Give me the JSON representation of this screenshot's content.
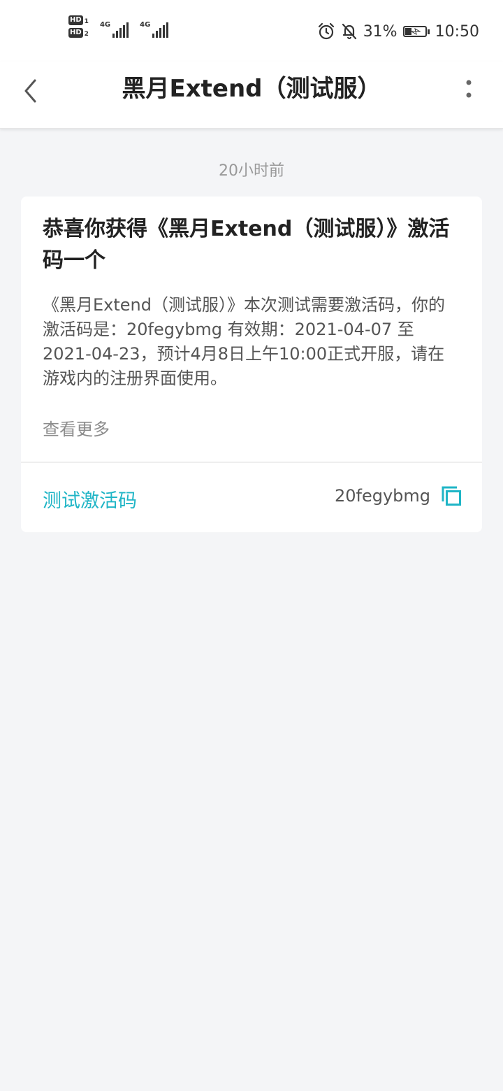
{
  "status_bar": {
    "hd1": "HD",
    "hd1_sub": "1",
    "hd2": "HD",
    "hd2_sub": "2",
    "signal1_label": "4G",
    "signal2_label": "4G",
    "battery_percent": "31%",
    "time": "10:50",
    "battery_level": 0.31
  },
  "header": {
    "title": "黑月Extend（测试服）"
  },
  "message": {
    "timestamp": "20小时前",
    "title": "恭喜你获得《黑月Extend（测试服）》激活码一个",
    "body": "《黑月Extend（测试服）》本次测试需要激活码，你的激活码是：20fegybmg 有效期：2021-04-07 至 2021-04-23，预计4月8日上午10:00正式开服，请在游戏内的注册界面使用。",
    "view_more": "查看更多",
    "code_label": "测试激活码",
    "code_value": "20fegybmg"
  },
  "icons": {
    "back": "chevron-left-icon",
    "more": "more-vertical-icon",
    "copy": "copy-icon",
    "alarm": "alarm-icon",
    "mute": "bell-off-icon",
    "battery": "battery-charging-icon"
  },
  "colors": {
    "accent": "#1fb5c6",
    "background": "#f4f5f7",
    "card": "#ffffff"
  }
}
